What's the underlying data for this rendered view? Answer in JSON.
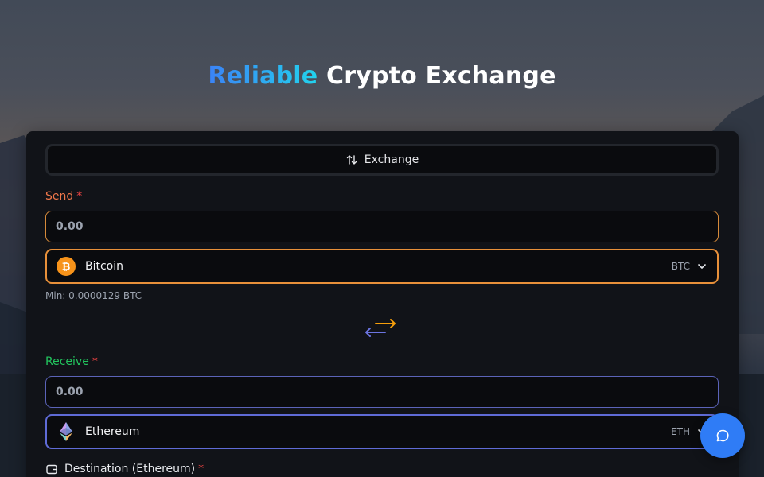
{
  "header": {
    "title_accent": "Reliable",
    "title_rest": "Crypto Exchange"
  },
  "tab": {
    "label": "Exchange",
    "icon": "arrows-up-down-icon"
  },
  "send": {
    "label": "Send",
    "required_mark": "*",
    "amount_value": "0.00",
    "currency_name": "Bitcoin",
    "currency_ticker": "BTC",
    "currency_icon": "bitcoin-icon",
    "min_text": "Min: 0.0000129 BTC",
    "accent_color": "#e8903a"
  },
  "swap": {
    "icon": "swap-arrows-icon"
  },
  "receive": {
    "label": "Receive",
    "required_mark": "*",
    "amount_value": "0.00",
    "currency_name": "Ethereum",
    "currency_ticker": "ETH",
    "currency_icon": "ethereum-icon",
    "accent_color": "#5f6bd6"
  },
  "destination": {
    "label": "Destination (Ethereum)",
    "required_mark": "*",
    "icon": "wallet-icon"
  },
  "chat": {
    "icon": "chat-bubble-icon",
    "color": "#2f7cf6"
  }
}
